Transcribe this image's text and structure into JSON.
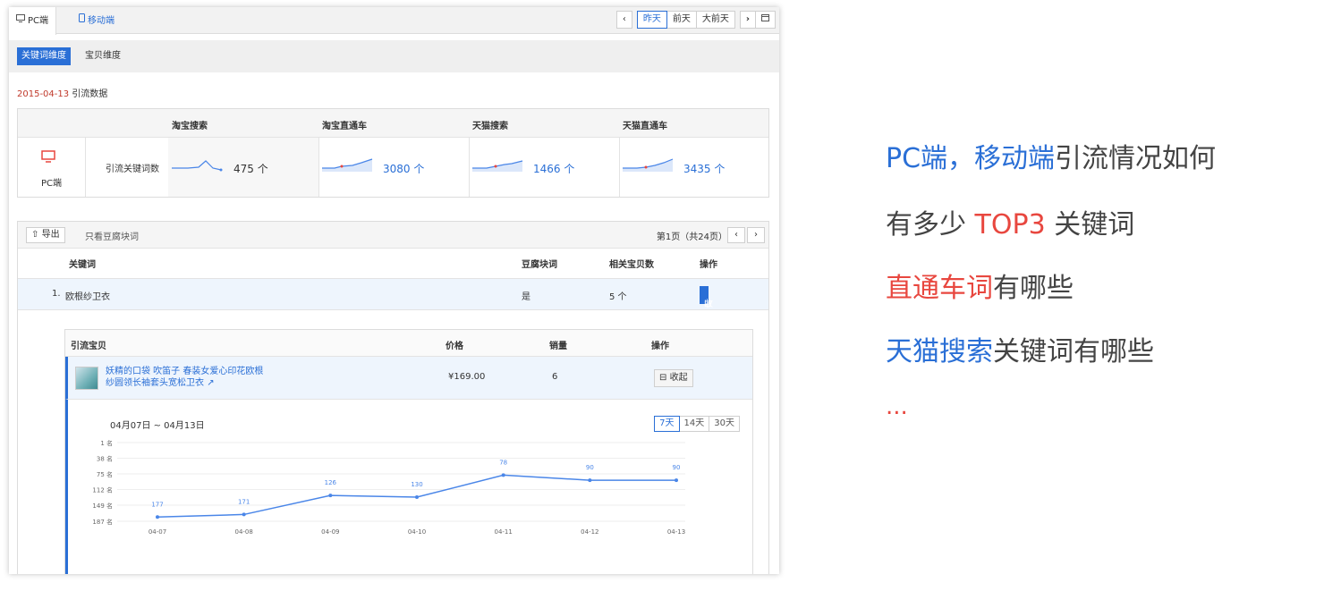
{
  "tabs": [
    {
      "label": "PC端",
      "icon": "monitor-icon"
    },
    {
      "label": "移动端",
      "icon": "mobile-icon"
    }
  ],
  "date_nav": {
    "prev": "<",
    "items": [
      "昨天",
      "前天",
      "大前天"
    ],
    "next": ">",
    "calendar": "calendar-icon"
  },
  "dimension_tabs": [
    "关键词维度",
    "宝贝维度"
  ],
  "date_label": {
    "date": "2015-04-13",
    "suffix": "引流数据"
  },
  "summary": {
    "columns": [
      "淘宝搜索",
      "淘宝直通车",
      "天猫搜索",
      "天猫直通车"
    ],
    "device_label": "PC端",
    "row_label": "引流关键词数",
    "values": [
      "475 个",
      "3080 个",
      "1466 个",
      "3435 个"
    ]
  },
  "list": {
    "export_label": "导出",
    "filter_label": "只看豆腐块词",
    "page_info": "第1页（共24页）",
    "headers": [
      "关键词",
      "豆腐块词",
      "相关宝贝数",
      "操作"
    ],
    "row": {
      "index": "1.",
      "keyword": "欧根纱卫衣",
      "tofu": "是",
      "count": "5 个",
      "action": "收起"
    }
  },
  "sub": {
    "headers": [
      "引流宝贝",
      "价格",
      "销量",
      "操作"
    ],
    "product": {
      "title_line1": "妖精的口袋 吹笛子 春装女爱心印花欧根",
      "title_line2": "纱圆领长袖套头宽松卫衣",
      "price": "¥169.00",
      "sales": "6",
      "action": "收起"
    },
    "range": "04月07日 ~ 04月13日",
    "range_buttons": [
      "7天",
      "14天",
      "30天"
    ]
  },
  "chart_data": {
    "type": "line",
    "x": [
      "04-07",
      "04-08",
      "04-09",
      "04-10",
      "04-11",
      "04-12",
      "04-13"
    ],
    "series": [
      {
        "values": [
          177,
          171,
          126,
          130,
          78,
          90,
          90
        ]
      }
    ],
    "y_ticks": [
      "1 名",
      "38 名",
      "75 名",
      "112 名",
      "149 名",
      "187 名"
    ],
    "y_inverted": true,
    "ylim": [
      1,
      187
    ],
    "line_color": "#4a86e8"
  },
  "side_text": {
    "line1_a": "PC端",
    "line1_b": "，",
    "line1_c": "移动端",
    "line1_d": "引流情况如何",
    "line2_a": "有多少 ",
    "line2_b": "TOP3",
    "line2_c": " 关键词",
    "line3_a": "直通车词",
    "line3_b": "有哪些",
    "line4_a": "天猫搜索",
    "line4_b": "关键词有哪些",
    "line5": "..."
  }
}
